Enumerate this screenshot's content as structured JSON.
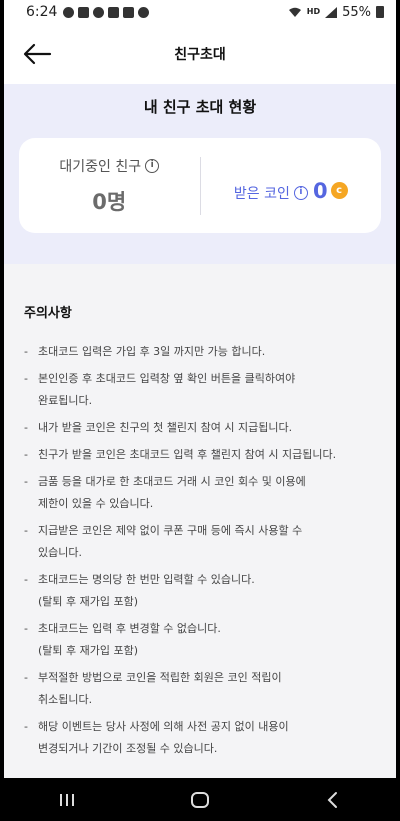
{
  "status_bar": {
    "time": "6:24",
    "network": "HD",
    "battery": "55%"
  },
  "header": {
    "title": "친구초대"
  },
  "summary": {
    "title": "내 친구 초대 현황",
    "pending": {
      "label": "대기중인 친구",
      "value": "0명"
    },
    "coins": {
      "label": "받은 코인",
      "value": "0",
      "coin_symbol": "c"
    }
  },
  "notice": {
    "title": "주의사항",
    "items": [
      [
        "초대코드 입력은 가입 후 3일 까지만 가능 합니다."
      ],
      [
        "본인인증 후 초대코드 입력창 옆 확인 버튼을 클릭하여야",
        "완료됩니다."
      ],
      [
        "내가 받을 코인은 친구의 첫 챌린지 참여 시 지급됩니다."
      ],
      [
        "친구가 받을 코인은 초대코드 입력 후 챌린지 참여 시 지급됩니다."
      ],
      [
        "금품 등을 대가로 한 초대코드 거래 시 코인 회수 및 이용에",
        "제한이 있을 수 있습니다."
      ],
      [
        "지급받은 코인은 제약 없이 쿠폰 구매 등에 즉시 사용할 수",
        "있습니다."
      ],
      [
        "초대코드는 명의당 한 번만 입력할 수 있습니다.",
        "(탈퇴 후 재가입 포함)"
      ],
      [
        "초대코드는 입력 후 변경할 수 없습니다.",
        "(탈퇴 후 재가입 포함)"
      ],
      [
        "부적절한 방법으로 코인을 적립한 회원은 코인 적립이",
        "취소됩니다."
      ],
      [
        "해당 이벤트는 당사 사정에 의해 사전 공지 없이 내용이",
        "변경되거나 기간이 조정될 수 있습니다."
      ]
    ]
  },
  "colors": {
    "accent": "#5566e0",
    "summary_bg": "#ecedfa",
    "coin": "#f5a623"
  }
}
